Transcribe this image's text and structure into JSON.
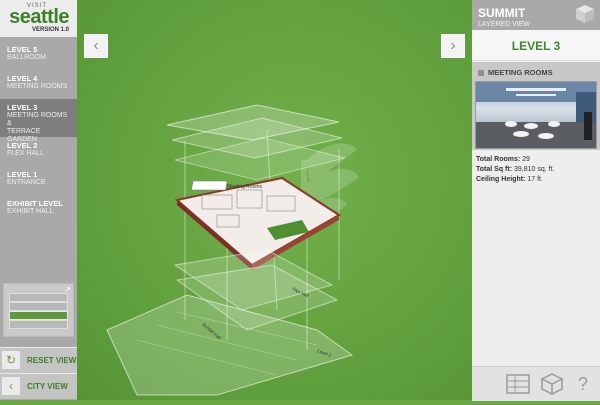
{
  "logo": {
    "visit": "VISIT",
    "brand": "seattle",
    "version": "VERSION 1.0"
  },
  "levels": [
    {
      "title": "LEVEL 5",
      "sub": "BALLROOM",
      "active": false
    },
    {
      "title": "LEVEL 4",
      "sub": "MEETING ROOMS",
      "active": false
    },
    {
      "title": "LEVEL 3",
      "sub": "MEETING ROOMS &",
      "sub2": "TERRACE GARDEN",
      "active": true
    },
    {
      "title": "LEVEL 2",
      "sub": "FLEX HALL",
      "active": false
    },
    {
      "title": "LEVEL 1",
      "sub": "ENTRANCE",
      "active": false
    },
    {
      "title": "EXHIBIT LEVEL",
      "sub": "EXHIBIT HALL",
      "active": false
    }
  ],
  "buttons": {
    "reset": "RESET VIEW",
    "city": "CITY VIEW"
  },
  "map": {
    "labels": [
      "Meeting Rooms",
      "Flex Hall",
      "Exhibit Hall",
      "Level 1"
    ]
  },
  "panel": {
    "title": "SUMMIT",
    "subtitle": "LAYERED VIEW",
    "level": "LEVEL 3",
    "section": "MEETING ROOMS",
    "stats": {
      "rooms_label": "Total Rooms:",
      "rooms_value": "29",
      "sqft_label": "Total Sq ft:",
      "sqft_value": "39,810 sq. ft.",
      "ceiling_label": "Ceiling Height:",
      "ceiling_value": "17 ft."
    }
  },
  "icons": {
    "help": "?",
    "prev": "‹",
    "next": "›",
    "reset": "↻",
    "back": "‹"
  },
  "colors": {
    "accent": "#3d7f2b",
    "map": "#6aa845",
    "sidebar": "#a9a9a9"
  }
}
